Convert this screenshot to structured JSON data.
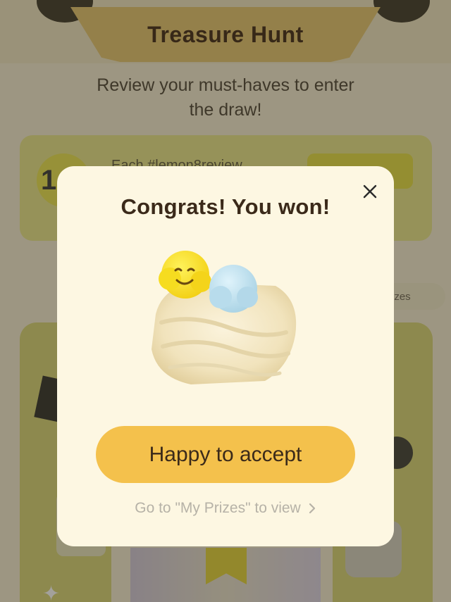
{
  "header": {
    "title": "Treasure Hunt"
  },
  "intro": {
    "subtitle": "Review your must-haves to enter the draw!"
  },
  "task": {
    "badge": "1",
    "text": "Each #lemon8review"
  },
  "prizes_pill": {
    "label": "izes"
  },
  "modal": {
    "title": "Congrats! You won!",
    "prize_icon": "plush-roll-cake-image",
    "accept_label": "Happy to accept",
    "prizes_link_label": "Go to \"My Prizes\" to view",
    "close_icon": "close-icon",
    "chevron_icon": "chevron-right-icon"
  },
  "colors": {
    "accent": "#f4c14c",
    "modal_bg": "#fdf7e2",
    "title_text": "#3b2a1a",
    "link_text": "#b6b2a7",
    "overlay": "rgba(50,46,35,0.45)"
  }
}
